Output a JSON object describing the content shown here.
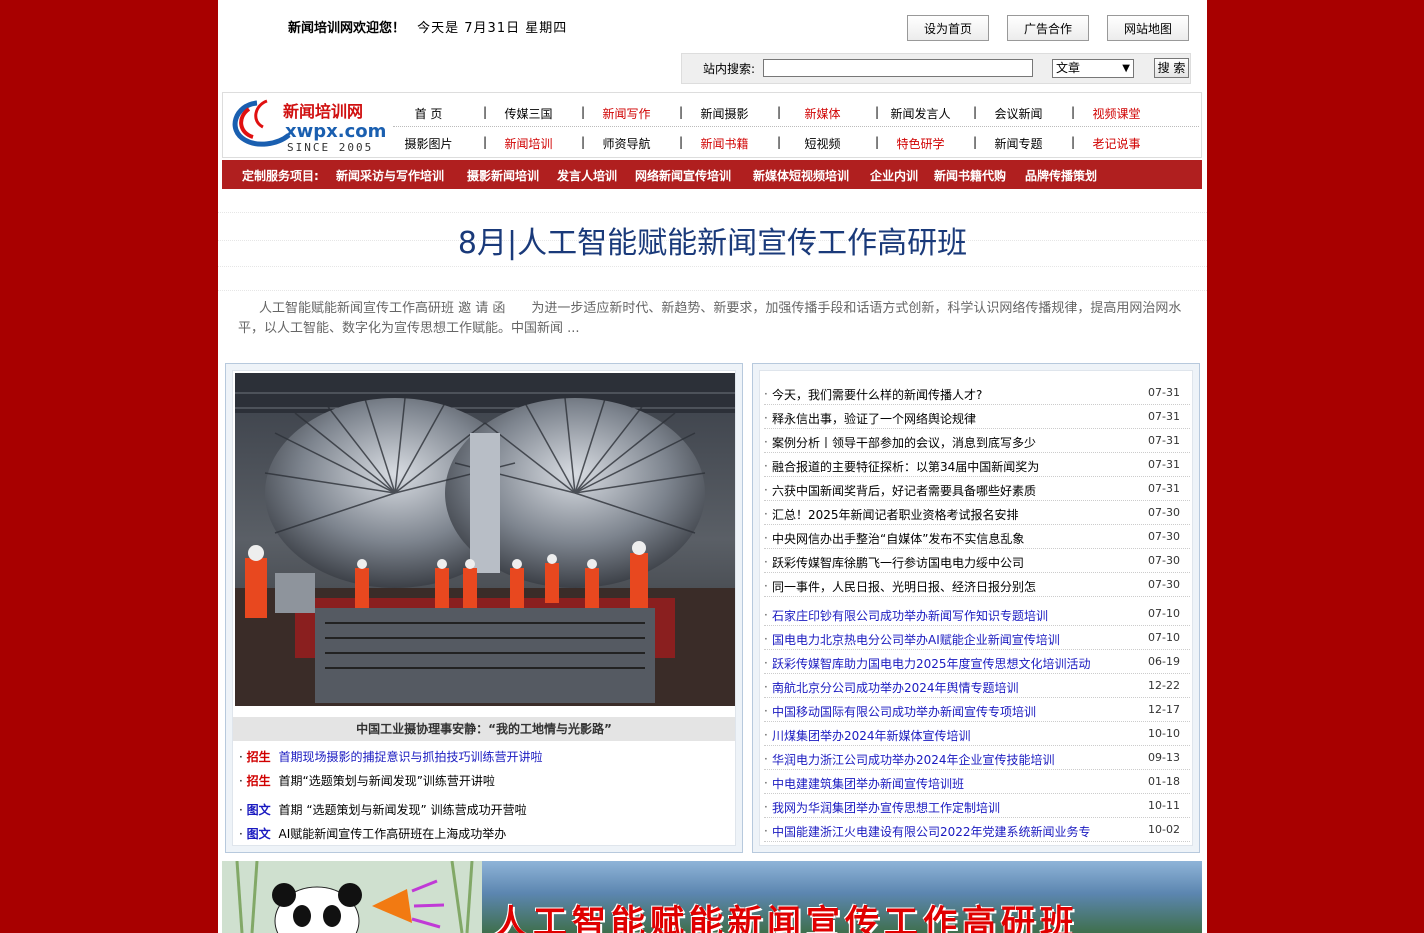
{
  "header": {
    "site_welcome": "新闻培训网欢迎您！",
    "date_text": "今天是 7月31日 星期四",
    "buttons": [
      "设为首页",
      "广告合作",
      "网站地图"
    ]
  },
  "search": {
    "label": "站内搜索:",
    "input_value": "",
    "select_value": "文章",
    "button_label": "搜 索"
  },
  "logo": {
    "name_cn": "新闻培训网",
    "domain": "xwpx.com",
    "since": "SINCE 2005"
  },
  "nav": {
    "row1": [
      {
        "label": "首 页",
        "red": false
      },
      {
        "label": "传媒三国",
        "red": false
      },
      {
        "label": "新闻写作",
        "red": true
      },
      {
        "label": "新闻摄影",
        "red": false
      },
      {
        "label": "新媒体",
        "red": true
      },
      {
        "label": "新闻发言人",
        "red": false
      },
      {
        "label": "会议新闻",
        "red": false
      },
      {
        "label": "视频课堂",
        "red": true
      }
    ],
    "row2": [
      {
        "label": "摄影图片",
        "red": false
      },
      {
        "label": "新闻培训",
        "red": true
      },
      {
        "label": "师资导航",
        "red": false
      },
      {
        "label": "新闻书籍",
        "red": true
      },
      {
        "label": "短视频",
        "red": false
      },
      {
        "label": "特色研学",
        "red": true
      },
      {
        "label": "新闻专题",
        "red": false
      },
      {
        "label": "老记说事",
        "red": true
      }
    ],
    "divider": "|"
  },
  "services": {
    "label": "定制服务项目:",
    "items": [
      "新闻采访与写作培训",
      "摄影新闻培训",
      "发言人培训",
      "网络新闻宣传培训",
      "新媒体短视频培训",
      "企业内训",
      "新闻书籍代购",
      "品牌传播策划"
    ]
  },
  "headline": {
    "title": "8月|人工智能赋能新闻宣传工作高研班",
    "description": "人工智能赋能新闻宣传工作高研班 邀 请 函　　为进一步适应新时代、新趋势、新要求，加强传播手段和话语方式创新，科学认识网络传播规律，提高用网治网水平，以人工智能、数字化为宣传思想工作赋能。中国新闻 ..."
  },
  "feature": {
    "photo_caption": "中国工业摄协理事安静：“我的工地情与光影路”",
    "items": [
      {
        "tag": "招生",
        "tag_color": "red",
        "text": "首期现场摄影的捕捉意识与抓拍技巧训练营开讲啦",
        "link": true
      },
      {
        "tag": "招生",
        "tag_color": "red",
        "text": "首期“选题策划与新闻发现”训练营开讲啦",
        "link": false
      },
      {
        "tag": "图文",
        "tag_color": "blue",
        "text": "首期 “选题策划与新闻发现” 训练营成功开营啦",
        "link": false
      },
      {
        "tag": "图文",
        "tag_color": "blue",
        "text": "AI赋能新闻宣传工作高研班在上海成功举办",
        "link": false
      }
    ]
  },
  "news": {
    "bullet": "·",
    "group1": [
      {
        "title": "今天，我们需要什么样的新闻传播人才?",
        "date": "07-31"
      },
      {
        "title": "释永信出事，验证了一个网络舆论规律",
        "date": "07-31"
      },
      {
        "title": "案例分析丨领导干部参加的会议，消息到底写多少",
        "date": "07-31"
      },
      {
        "title": "融合报道的主要特征探析：以第34届中国新闻奖为",
        "date": "07-31"
      },
      {
        "title": "六获中国新闻奖背后，好记者需要具备哪些好素质",
        "date": "07-31"
      },
      {
        "title": "汇总！2025年新闻记者职业资格考试报名安排",
        "date": "07-30"
      },
      {
        "title": "中央网信办出手整治“自媒体”发布不实信息乱象",
        "date": "07-30"
      },
      {
        "title": "跃彩传媒智库徐鹏飞一行参访国电电力绥中公司",
        "date": "07-30"
      },
      {
        "title": "同一事件，人民日报、光明日报、经济日报分别怎",
        "date": "07-30"
      }
    ],
    "group2": [
      {
        "title": "石家庄印钞有限公司成功举办新闻写作知识专题培训",
        "date": "07-10"
      },
      {
        "title": "国电电力北京热电分公司举办AI赋能企业新闻宣传培训",
        "date": "07-10"
      },
      {
        "title": "跃彩传媒智库助力国电电力2025年度宣传思想文化培训活动",
        "date": "06-19"
      },
      {
        "title": "南航北京分公司成功举办2024年舆情专题培训",
        "date": "12-22"
      },
      {
        "title": "中国移动国际有限公司成功举办新闻宣传专项培训",
        "date": "12-17"
      },
      {
        "title": "川煤集团举办2024年新媒体宣传培训",
        "date": "10-10"
      },
      {
        "title": "华润电力浙江公司成功举办2024年企业宣传技能培训",
        "date": "09-13"
      },
      {
        "title": "中电建建筑集团举办新闻宣传培训班",
        "date": "01-18"
      },
      {
        "title": "我网为华润集团举办宣传思想工作定制培训",
        "date": "10-11"
      },
      {
        "title": "中国能建浙江火电建设有限公司2022年党建系统新闻业务专",
        "date": "10-02"
      }
    ]
  },
  "banner": {
    "text": "人工智能赋能新闻宣传工作高研班"
  },
  "colors": {
    "background": "#a80000",
    "service_bar": "#b01f1f",
    "headline": "#1a3a7a",
    "link_blue": "#1a1ac0",
    "accent_red": "#d00000"
  }
}
